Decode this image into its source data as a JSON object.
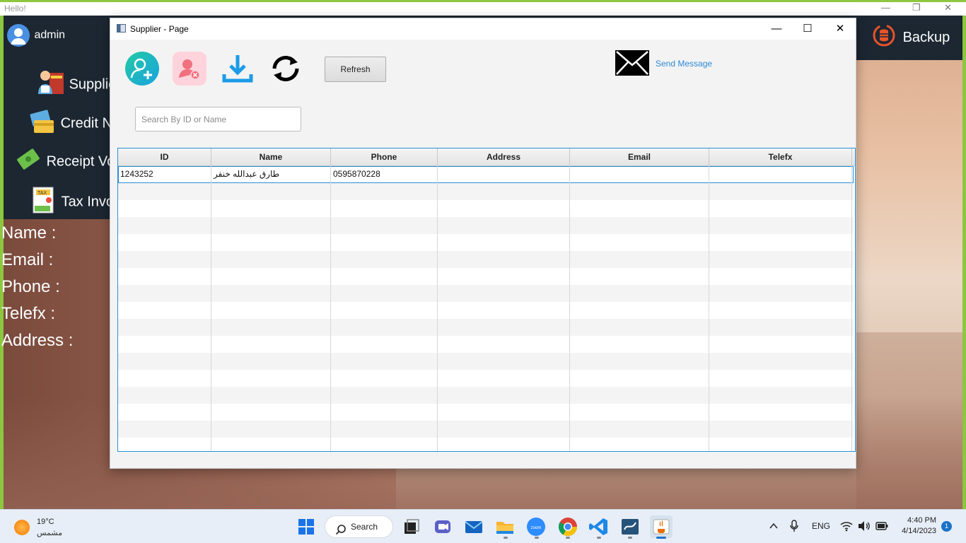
{
  "outer_window": {
    "title": "Hello!",
    "user_name": "admin",
    "backup_label": "Backup",
    "nav": [
      {
        "label": "Supplie",
        "icon": "supplier-icon"
      },
      {
        "label": "Credit N",
        "icon": "credit-card-icon"
      },
      {
        "label": "Receipt Vo",
        "icon": "receipt-icon"
      },
      {
        "label": "Tax Invo",
        "icon": "tax-icon"
      }
    ],
    "fields": [
      "Name :",
      "Email :",
      "Phone :",
      "Telefx :",
      "Address :"
    ]
  },
  "dialog": {
    "title": "Supplier - Page",
    "refresh_label": "Refresh",
    "send_message_label": "Send Message",
    "search_placeholder": "Search By ID or Name",
    "tool_icons": [
      "add-user-icon",
      "remove-user-icon",
      "download-icon",
      "sync-icon"
    ],
    "table": {
      "columns": [
        "ID",
        "Name",
        "Phone",
        "Address",
        "Email",
        "Telefx"
      ],
      "rows": [
        [
          "1243252",
          "طارق عبدالله خنفر",
          "0595870228",
          "",
          "",
          ""
        ]
      ],
      "empty_row_count": 16
    }
  },
  "taskbar": {
    "weather_temp": "19°C",
    "weather_condition": "مشمس",
    "search_label": "Search",
    "language": "ENG",
    "time": "4:40 PM",
    "date": "4/14/2023",
    "notification_count": "1"
  }
}
